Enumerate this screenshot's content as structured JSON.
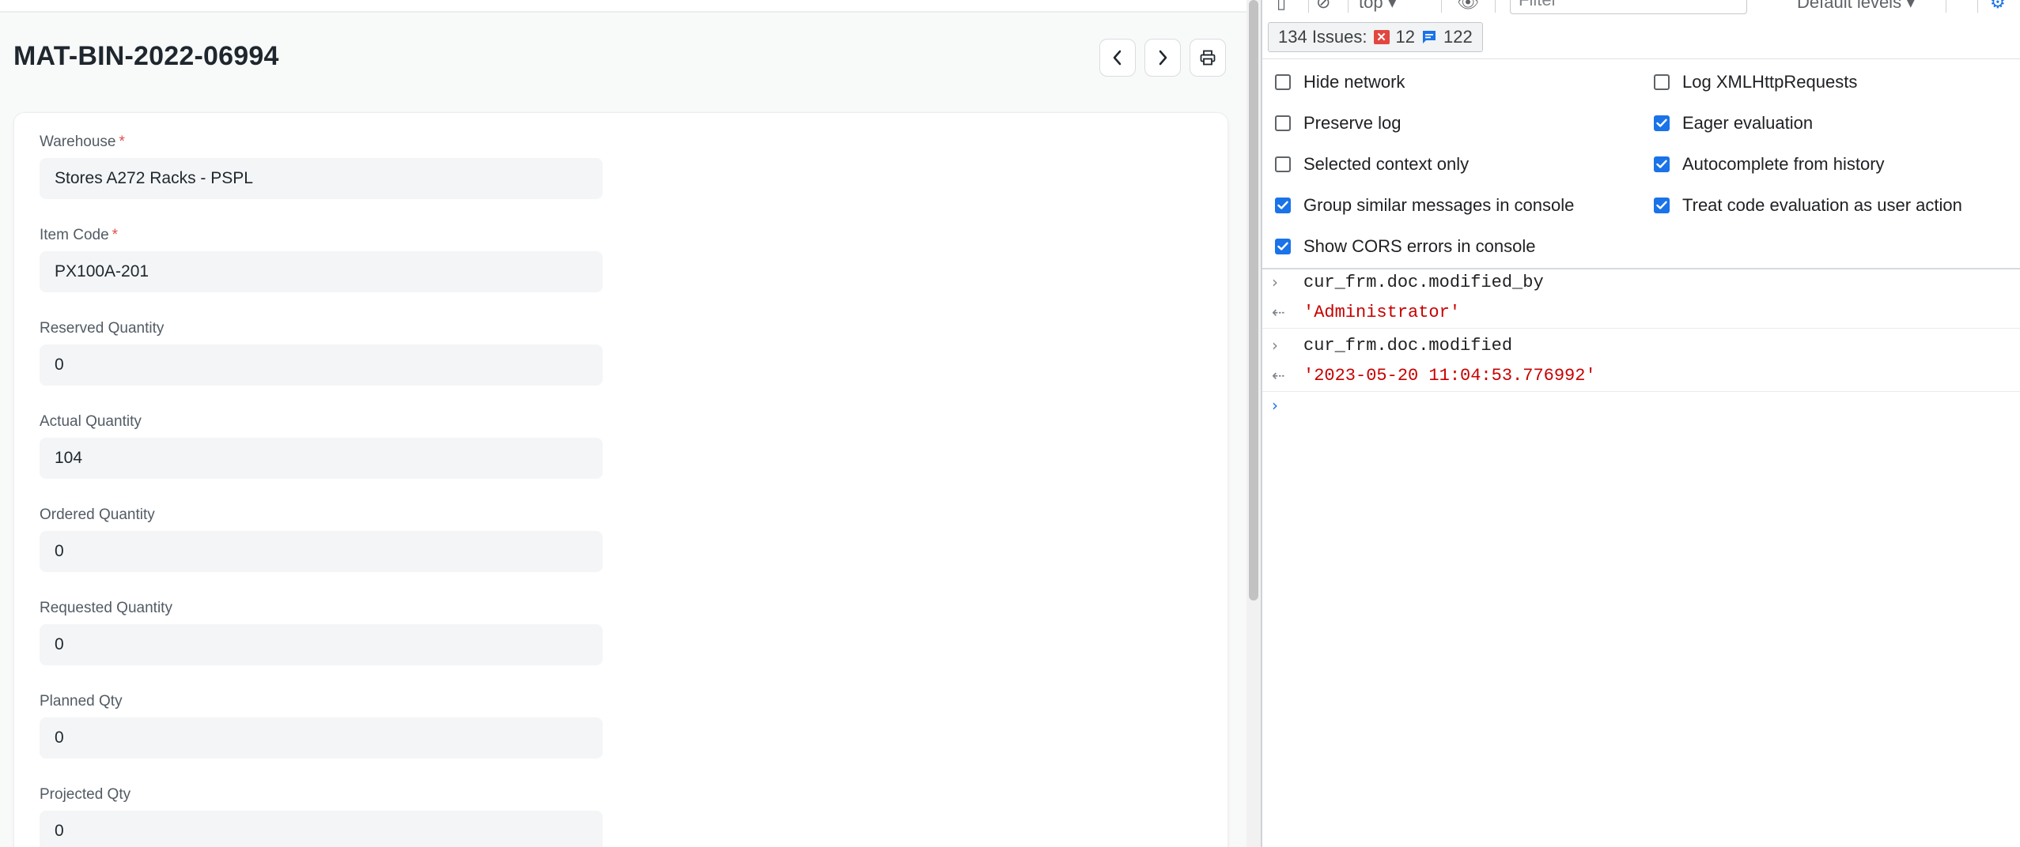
{
  "app": {
    "doc_title": "MAT-BIN-2022-06994",
    "fields": [
      {
        "label": "Warehouse",
        "required": "*",
        "value": "Stores A272 Racks - PSPL"
      },
      {
        "label": "Item Code",
        "required": "*",
        "value": "PX100A-201"
      },
      {
        "label": "Reserved Quantity",
        "value": "0"
      },
      {
        "label": "Actual Quantity",
        "value": "104"
      },
      {
        "label": "Ordered Quantity",
        "value": "0"
      },
      {
        "label": "Requested Quantity",
        "value": "0"
      },
      {
        "label": "Planned Qty",
        "value": "0"
      },
      {
        "label": "Projected Qty",
        "value": "0"
      }
    ],
    "icons": {
      "prev": "chevron-left-icon",
      "next": "chevron-right-icon",
      "print": "printer-icon"
    }
  },
  "devtools": {
    "toolbar": {
      "context": "top",
      "filter_placeholder": "Filter",
      "levels": "Default levels"
    },
    "issues": {
      "label": "134 Issues:",
      "errors": "12",
      "messages": "122"
    },
    "settings": [
      {
        "label": "Hide network",
        "checked": false
      },
      {
        "label": "Log XMLHttpRequests",
        "checked": false
      },
      {
        "label": "Preserve log",
        "checked": false
      },
      {
        "label": "Eager evaluation",
        "checked": true
      },
      {
        "label": "Selected context only",
        "checked": false
      },
      {
        "label": "Autocomplete from history",
        "checked": true
      },
      {
        "label": "Group similar messages in console",
        "checked": true
      },
      {
        "label": "Treat code evaluation as user action",
        "checked": true
      },
      {
        "label": "Show CORS errors in console",
        "checked": true
      }
    ],
    "console": [
      {
        "kind": "input",
        "text": "cur_frm.doc.modified_by"
      },
      {
        "kind": "output",
        "text": "'Administrator'"
      },
      {
        "kind": "input",
        "text": "cur_frm.doc.modified"
      },
      {
        "kind": "output",
        "text": "'2023-05-20 11:04:53.776992'"
      }
    ],
    "colors": {
      "accent": "#1a73e8",
      "error": "#e2463f",
      "string": "#c80000"
    }
  }
}
